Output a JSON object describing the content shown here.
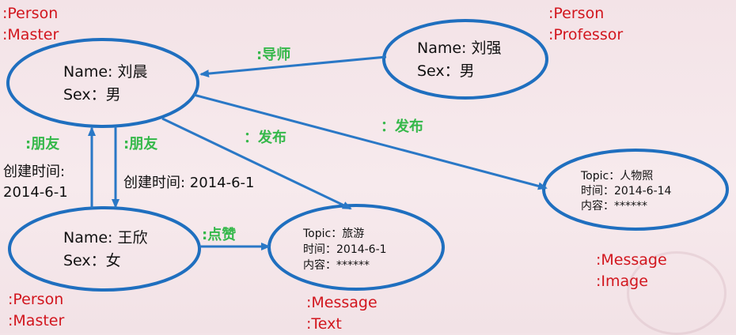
{
  "nodes": {
    "liuchen": {
      "name": "Name: 刘晨",
      "sex": "Sex：男",
      "types": [
        ":Person",
        ":Master"
      ]
    },
    "liuqiang": {
      "name": "Name: 刘强",
      "sex": "Sex：男",
      "types": [
        ":Person",
        ":Professor"
      ]
    },
    "wangxin": {
      "name": "Name: 王欣",
      "sex": "Sex：女",
      "types": [
        ":Person",
        ":Master"
      ]
    },
    "msg_text": {
      "topic": "Topic：旅游",
      "time": "时间：2014-6-1",
      "content": "内容：******",
      "types": [
        ":Message",
        ":Text"
      ]
    },
    "msg_image": {
      "topic": "Topic：人物照",
      "time": "时间：2014-6-14",
      "content": "内容：******",
      "types": [
        ":Message",
        ":Image"
      ]
    }
  },
  "edges": {
    "advisor": ":导师",
    "friend_left": ":朋友",
    "friend_left_time_label": "创建时间:",
    "friend_left_time_value": "2014-6-1",
    "friend_right": ":朋友",
    "friend_right_time": "创建时间: 2014-6-1",
    "publish_text": "：发布",
    "publish_image": "：发布",
    "like": ":点赞"
  },
  "colors": {
    "node_stroke": "#1f6fbf",
    "edge_stroke": "#2a78c6",
    "type_text": "#d2161e",
    "edge_text": "#35b84a"
  }
}
